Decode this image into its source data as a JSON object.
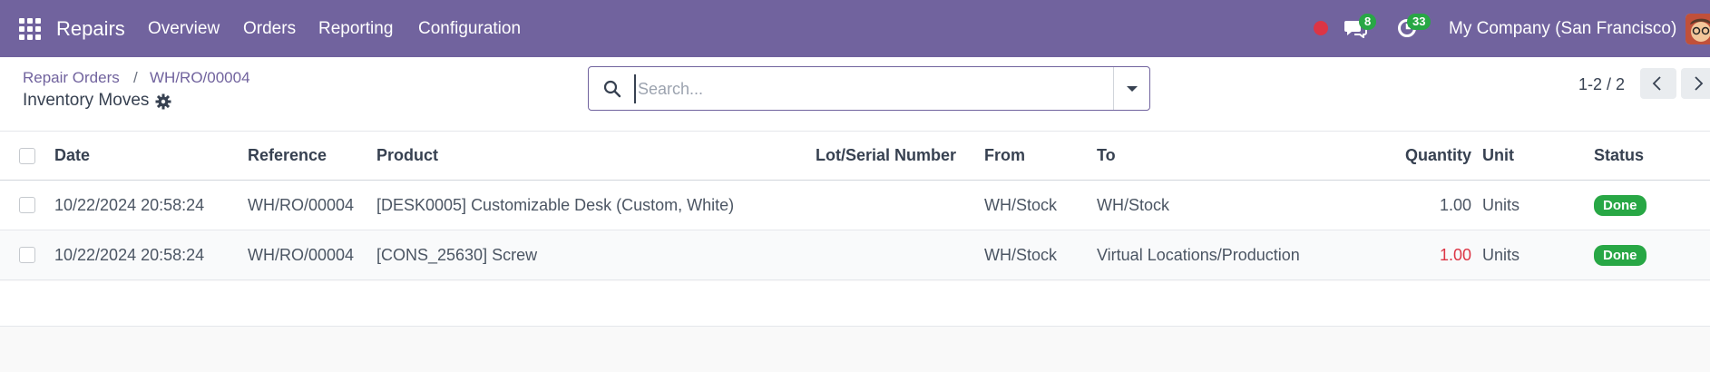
{
  "navbar": {
    "app_name": "Repairs",
    "menu": [
      "Overview",
      "Orders",
      "Reporting",
      "Configuration"
    ],
    "messages_count": "8",
    "activities_count": "33",
    "company": "My Company (San Francisco)",
    "colors": {
      "bar": "#71639e",
      "badge": "#28a745",
      "dot": "#dc3545"
    }
  },
  "breadcrumb": {
    "parent": "Repair Orders",
    "separator": "/",
    "current": "WH/RO/00004",
    "subtitle": "Inventory Moves"
  },
  "search": {
    "placeholder": "Search..."
  },
  "pager": {
    "text": "1-2 / 2"
  },
  "table": {
    "headers": {
      "date": "Date",
      "reference": "Reference",
      "product": "Product",
      "lot": "Lot/Serial Number",
      "from": "From",
      "to": "To",
      "quantity": "Quantity",
      "unit": "Unit",
      "status": "Status"
    },
    "rows": [
      {
        "date": "10/22/2024 20:58:24",
        "reference": "WH/RO/00004",
        "product": "[DESK0005] Customizable Desk (Custom, White)",
        "lot": "",
        "from": "WH/Stock",
        "to": "WH/Stock",
        "quantity": "1.00",
        "unit": "Units",
        "status": "Done"
      },
      {
        "date": "10/22/2024 20:58:24",
        "reference": "WH/RO/00004",
        "product": "[CONS_25630] Screw",
        "lot": "",
        "from": "WH/Stock",
        "to": "Virtual Locations/Production",
        "quantity": "1.00",
        "unit": "Units",
        "status": "Done"
      }
    ]
  }
}
